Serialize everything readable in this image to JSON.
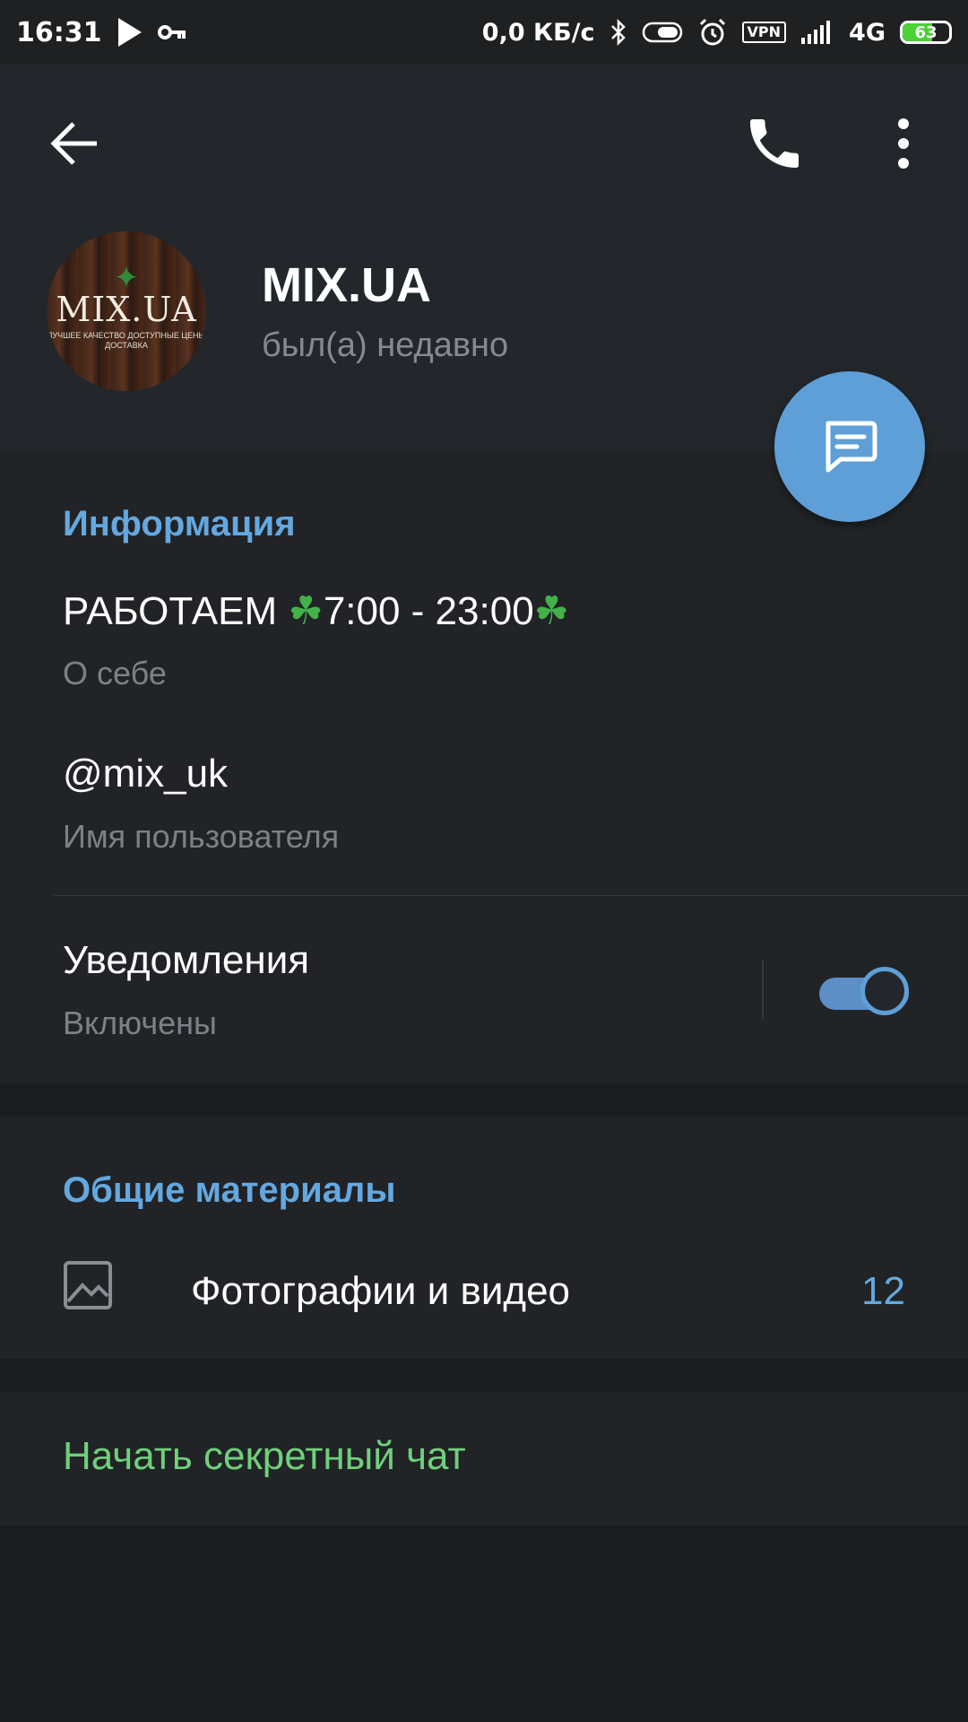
{
  "status_bar": {
    "time": "16:31",
    "speed": "0,0 КБ/с",
    "vpn": "VPN",
    "network": "4G",
    "battery": "63",
    "battery_level": 0.63,
    "icons": [
      "play-icon",
      "key-icon",
      "bluetooth-icon",
      "toggle-icon",
      "alarm-icon",
      "vpn-icon",
      "signal-icon",
      "battery-icon"
    ]
  },
  "header": {
    "name": "MIX.UA",
    "status": "был(а) недавно",
    "avatar": {
      "logo": "MIX.UA",
      "tagline": "ЛУЧШЕЕ КАЧЕСТВО ДОСТУПНЫЕ ЦЕНЫ ДОСТАВКА"
    },
    "icons": [
      "back-arrow-icon",
      "phone-icon",
      "more-vert-icon",
      "message-icon"
    ]
  },
  "info": {
    "title": "Информация",
    "bio": {
      "text_before": "РАБОТАЕМ ",
      "clover": "☘",
      "hours": "7:00 - 23:00",
      "label": "О себе"
    },
    "username": {
      "value": "@mix_uk",
      "label": "Имя пользователя"
    },
    "notifications": {
      "title": "Уведомления",
      "status": "Включены",
      "enabled": true
    }
  },
  "media": {
    "title": "Общие материалы",
    "photos_label": "Фотографии и видео",
    "photos_count": "12"
  },
  "secret_chat": {
    "label": "Начать секретный чат"
  },
  "colors": {
    "accent": "#64a8e0",
    "secret_green": "#6fd07b",
    "fab": "#5e9fd7",
    "header_bg": "#23272b",
    "section_bg": "#212326"
  }
}
